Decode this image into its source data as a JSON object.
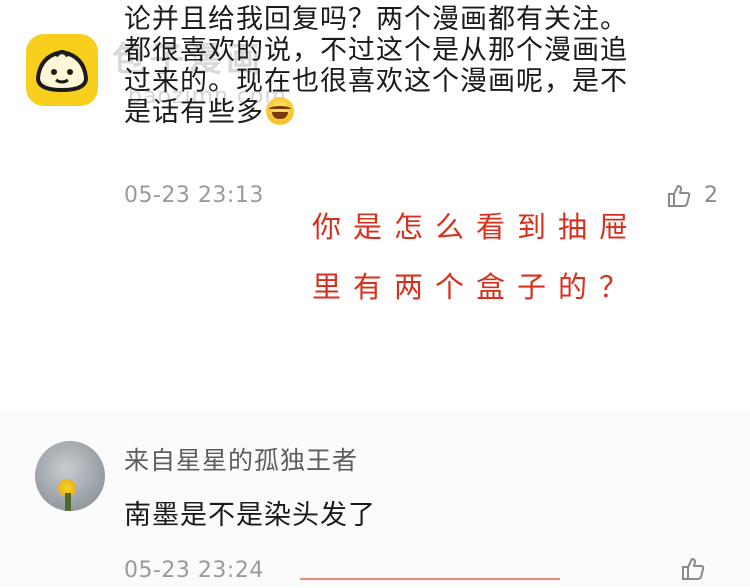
{
  "comment1": {
    "lines": [
      "论并且给我回复吗？两个漫画都有关注。",
      "都很喜欢的说，不过这个是从那个漫画追",
      "过来的。现在也很喜欢这个漫画呢，是不",
      "是话有些多"
    ],
    "emoji": "laughing-with-tears",
    "timestamp": "05-23 23:13",
    "like_count": "2"
  },
  "watermark": {
    "text": "包子漫画",
    "url": "baozimh.com"
  },
  "handwritten_note": {
    "lines": [
      "你是怎么看到抽屉",
      "里有两个盒子的？"
    ],
    "color": "#d9301e"
  },
  "comment2": {
    "username": "来自星星的孤独王者",
    "text": "南墨是不是染头发了",
    "timestamp": "05-23 23:24"
  },
  "colors": {
    "text": "#1b1b1b",
    "meta": "#9a9a9a",
    "accent_red": "#d9301e",
    "logo_yellow": "#f8cf1c"
  }
}
